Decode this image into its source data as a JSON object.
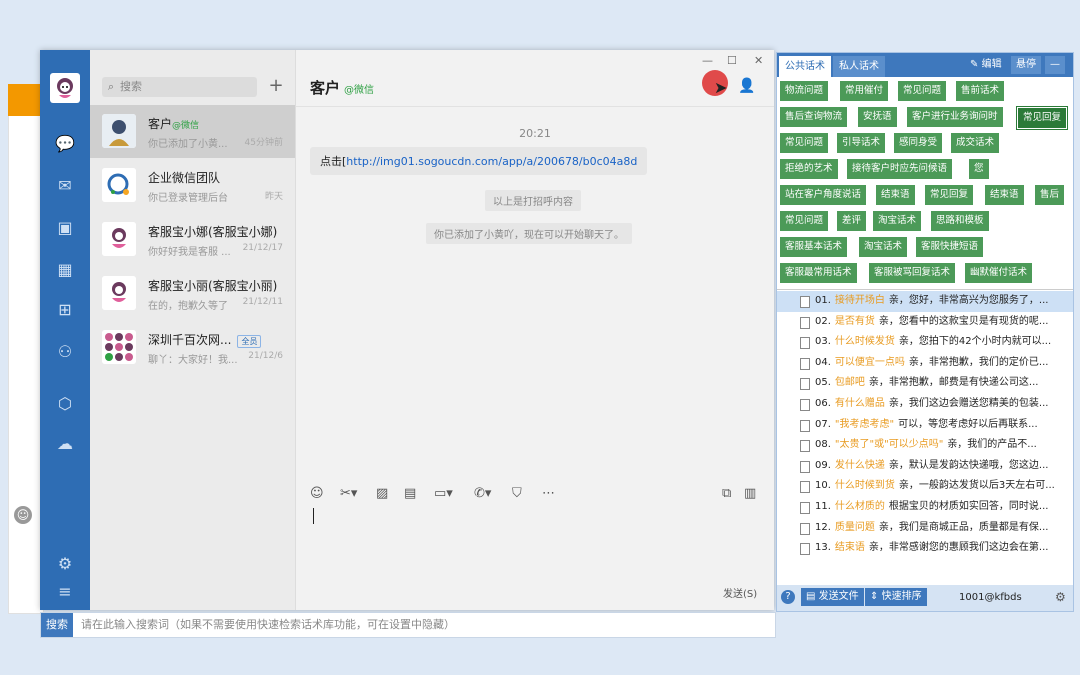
{
  "chat_list": {
    "search_placeholder": "搜索",
    "add_symbol": "+",
    "items": [
      {
        "name": "客户",
        "tag": "@微信",
        "msg": "你已添加了小黄...",
        "time": "45分钟前"
      },
      {
        "name": "企业微信团队",
        "tag": "",
        "msg": "你已登录管理后台",
        "time": "昨天"
      },
      {
        "name": "客服宝小娜(客服宝小娜)",
        "tag": "",
        "msg": "你好好我是客服 ...",
        "time": "21/12/17"
      },
      {
        "name": "客服宝小丽(客服宝小丽)",
        "tag": "",
        "msg": "在的，抱歉久等了",
        "time": "21/12/11"
      },
      {
        "name": "深圳千百次网...",
        "tag": "",
        "badge": "全员",
        "msg": "聊丫：大家好！我...",
        "time": "21/12/6"
      }
    ]
  },
  "chat": {
    "title": "客户",
    "title_tag": "@微信",
    "window_controls": {
      "min": "—",
      "max": "☐",
      "close": "✕"
    },
    "time": "20:21",
    "message_prefix": "点击[",
    "message_link": "http://img01.sogoucdn.com/app/a/200678/b0c04a8d",
    "system_1": "以上是打招呼内容",
    "system_2": "你已添加了小黄吖，现在可以开始聊天了。",
    "send_label": "发送(S)"
  },
  "bottom_search": {
    "button": "搜索",
    "hint": "请在此输入搜索词（如果不需要使用快速检索话术库功能，可在设置中隐藏）"
  },
  "script_panel": {
    "tabs": [
      "公共话术",
      "私人话术"
    ],
    "edit_label": "编辑",
    "pin_label": "悬停",
    "min_label": "—",
    "categories": [
      "物流问题",
      "常用催付",
      "常见问题",
      "售前话术",
      "售后查询物流",
      "安抚语",
      "客户进行业务询问时",
      "常见回复",
      "常见问题",
      "引导话术",
      "感同身受",
      "成交话术",
      "拒绝的艺术",
      "接待客户时应先问候语",
      "您",
      "站在客户角度说话",
      "结束语",
      "常见回复",
      "结束语",
      "售后",
      "常见问题",
      "差评",
      "淘宝话术",
      "思路和模板",
      "客服基本话术",
      "淘宝话术",
      "客服快捷短语",
      "客服最常用话术",
      "客服被骂回复话术",
      "幽默催付话术"
    ],
    "scripts": [
      {
        "num": "01.",
        "kw": "接待开场白",
        "text": "亲，您好，非常高兴为您服务了，..."
      },
      {
        "num": "02.",
        "kw": "是否有货",
        "text": "亲，您看中的这款宝贝是有现货的呢..."
      },
      {
        "num": "03.",
        "kw": "什么时候发货",
        "text": "亲，您拍下的42个小时内就可以..."
      },
      {
        "num": "04.",
        "kw": "可以便宜一点吗",
        "text": "亲，非常抱歉，我们的定价已..."
      },
      {
        "num": "05.",
        "kw": "包邮吧",
        "text": "亲，非常抱歉，邮费是有快递公司这..."
      },
      {
        "num": "06.",
        "kw": "有什么赠品",
        "text": "亲，我们这边会赠送您精美的包装..."
      },
      {
        "num": "07.",
        "kw": "\"我考虑考虑\"",
        "text": "可以，等您考虑好以后再联系..."
      },
      {
        "num": "08.",
        "kw": "\"太贵了\"或\"可以少点吗\"",
        "text": "亲，我们的产品不..."
      },
      {
        "num": "09.",
        "kw": "发什么快递",
        "text": "亲，默认是发韵达快递哦，您这边..."
      },
      {
        "num": "10.",
        "kw": "什么时候到货",
        "text": "亲，一般韵达发货以后3天左右可..."
      },
      {
        "num": "11.",
        "kw": "什么材质的",
        "text": "根据宝贝的材质如实回答，同时说..."
      },
      {
        "num": "12.",
        "kw": "质量问题",
        "text": "亲，我们是商城正品，质量都是有保..."
      },
      {
        "num": "13.",
        "kw": "结束语",
        "text": "亲，非常感谢您的惠顾我们这边会在第..."
      }
    ],
    "footer": {
      "help": "?",
      "send_file": "发送文件",
      "quick_sort": "快速排序",
      "user": "1001@kfbds"
    }
  }
}
